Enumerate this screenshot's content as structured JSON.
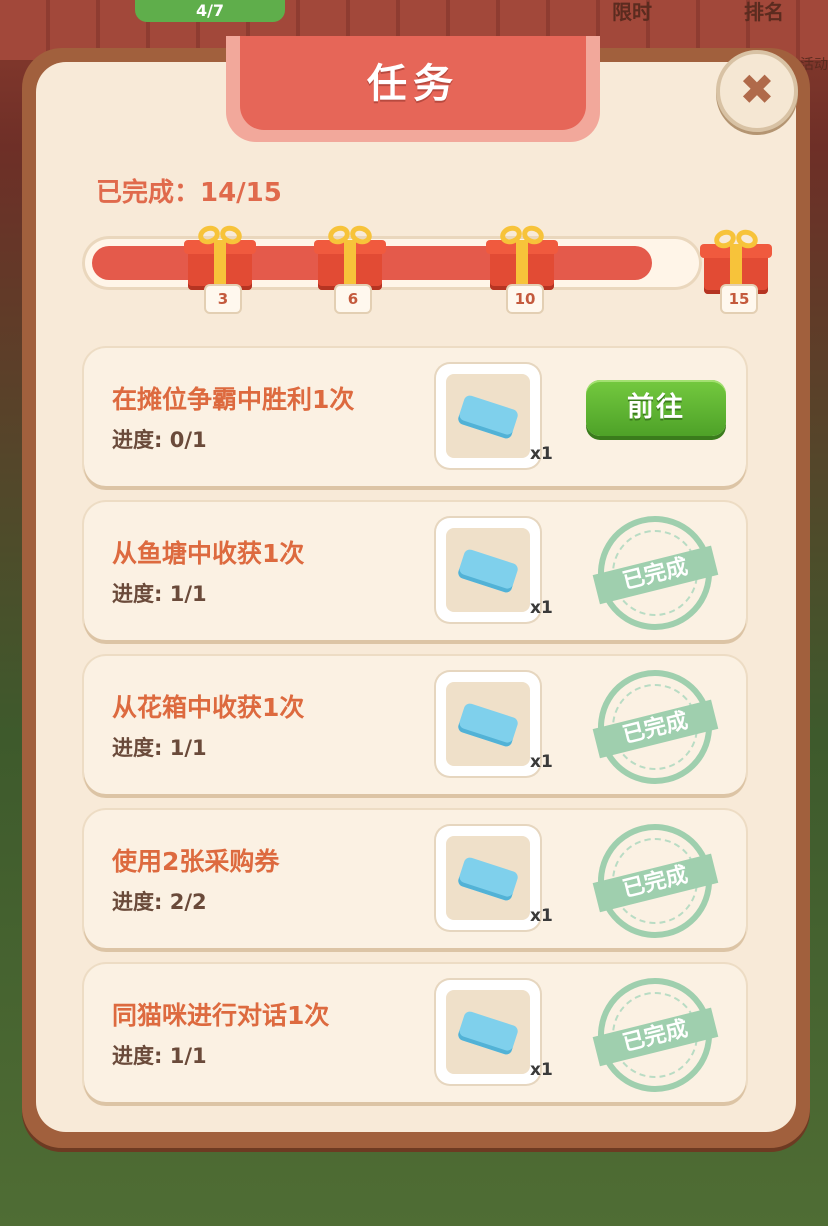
{
  "background": {
    "progress_pill": "4/7",
    "top_right_1": "限时",
    "top_right_2": "排名",
    "side_label": "活动"
  },
  "dialog": {
    "title": "任务",
    "close_icon": "close-icon"
  },
  "progress": {
    "label": "已完成：14/15",
    "completed": 14,
    "total": 15,
    "milestones": [
      {
        "value": "3",
        "icon": "gift-icon"
      },
      {
        "value": "6",
        "icon": "gift-icon"
      },
      {
        "value": "10",
        "icon": "gift-icon"
      },
      {
        "value": "15",
        "icon": "gift-icon"
      }
    ]
  },
  "tasks": [
    {
      "title": "在摊位争霸中胜利1次",
      "progress": "进度: 0/1",
      "reward_count": "x1",
      "action": "前往",
      "completed": false
    },
    {
      "title": "从鱼塘中收获1次",
      "progress": "进度: 1/1",
      "reward_count": "x1",
      "stamp": "已完成",
      "completed": true
    },
    {
      "title": "从花箱中收获1次",
      "progress": "进度: 1/1",
      "reward_count": "x1",
      "stamp": "已完成",
      "completed": true
    },
    {
      "title": "使用2张采购券",
      "progress": "进度: 2/2",
      "reward_count": "x1",
      "stamp": "已完成",
      "completed": true
    },
    {
      "title": "同猫咪进行对话1次",
      "progress": "进度: 1/1",
      "reward_count": "x1",
      "stamp": "已完成",
      "completed": true
    }
  ],
  "colors": {
    "accent_red": "#e66658",
    "task_title": "#dd6a3f",
    "go_button": "#5cb232",
    "stamp_green": "#9fcfae"
  }
}
